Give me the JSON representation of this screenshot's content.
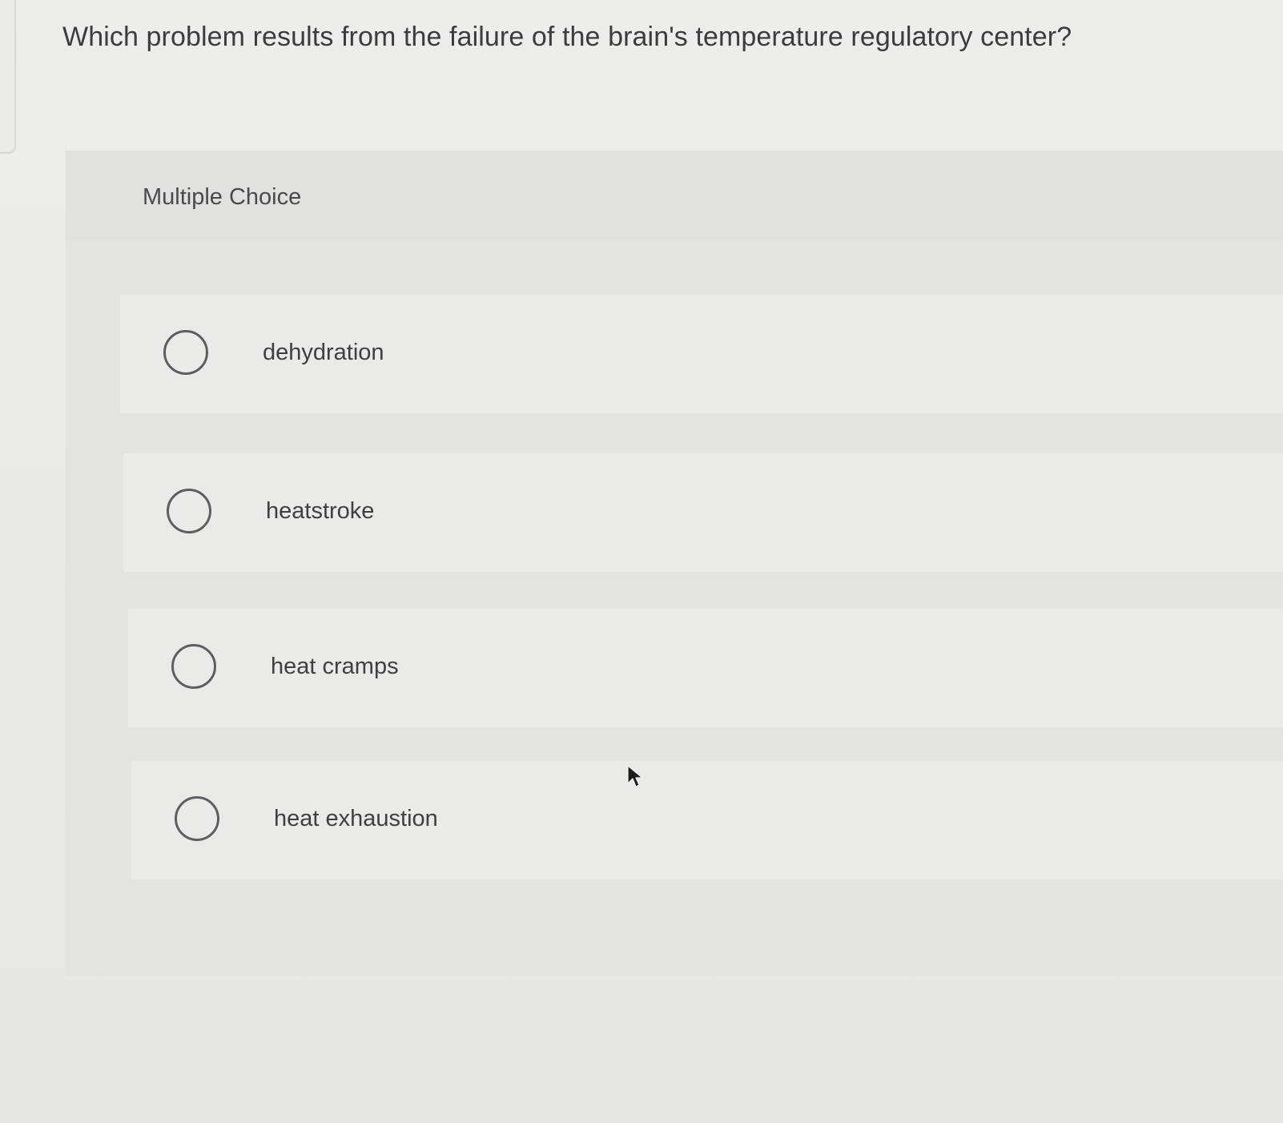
{
  "question": {
    "text": "Which problem results from the failure of the brain's temperature regulatory center?"
  },
  "panel": {
    "type_label": "Multiple Choice"
  },
  "choices": [
    {
      "label": "dehydration",
      "selected": false
    },
    {
      "label": "heatstroke",
      "selected": false
    },
    {
      "label": "heat cramps",
      "selected": false
    },
    {
      "label": "heat exhaustion",
      "selected": false
    }
  ],
  "icons": {
    "radio": "radio-button-icon",
    "cursor": "mouse-pointer-icon"
  },
  "colors": {
    "background": "#ebebe9",
    "panel": "#e3e3e1",
    "choice_row": "#eaeae8",
    "text": "#3c3c3e",
    "radio_border": "#5e5e62"
  }
}
